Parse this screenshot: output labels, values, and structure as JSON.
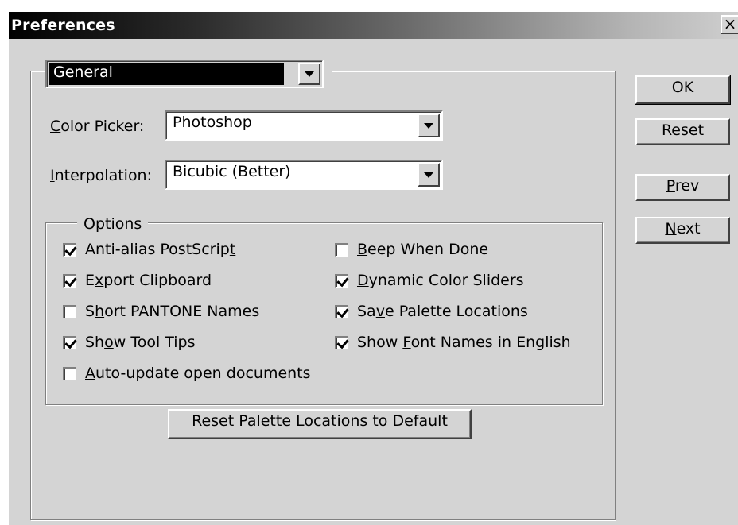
{
  "window": {
    "title": "Preferences",
    "close_glyph": "×",
    "close_icon": "close-icon"
  },
  "section_select": {
    "value": "General"
  },
  "color_picker": {
    "label_underlined": "C",
    "label_rest": "olor Picker:",
    "value": "Photoshop"
  },
  "interpolation": {
    "label_underlined": "I",
    "label_rest": "nterpolation:",
    "value": "Bicubic (Better)"
  },
  "options": {
    "legend": "Options",
    "items": [
      {
        "pre": "Anti-alias PostScrip",
        "u": "t",
        "post": "",
        "checked": true
      },
      {
        "pre": "E",
        "u": "x",
        "post": "port Clipboard",
        "checked": true
      },
      {
        "pre": "S",
        "u": "h",
        "post": "ort PANTONE Names",
        "checked": false
      },
      {
        "pre": "Sh",
        "u": "o",
        "post": "w Tool Tips",
        "checked": true
      },
      {
        "pre": "",
        "u": "A",
        "post": "uto-update open documents",
        "checked": false
      },
      {
        "pre": "",
        "u": "B",
        "post": "eep When Done",
        "checked": false
      },
      {
        "pre": "",
        "u": "D",
        "post": "ynamic Color Sliders",
        "checked": true
      },
      {
        "pre": "Sa",
        "u": "v",
        "post": "e Palette Locations",
        "checked": true
      },
      {
        "pre": "Show ",
        "u": "F",
        "post": "ont Names in English",
        "checked": true
      }
    ]
  },
  "reset_palette_button": {
    "pre": "R",
    "u": "e",
    "post": "set Palette Locations to Default"
  },
  "buttons": {
    "ok": "OK",
    "reset": "Reset",
    "prev_u": "P",
    "prev_rest": "rev",
    "next_u": "N",
    "next_rest": "ext"
  },
  "colors": {
    "window_bg": "#d4d4d4",
    "title_text": "#ffffff",
    "selection_bg": "#000000"
  }
}
